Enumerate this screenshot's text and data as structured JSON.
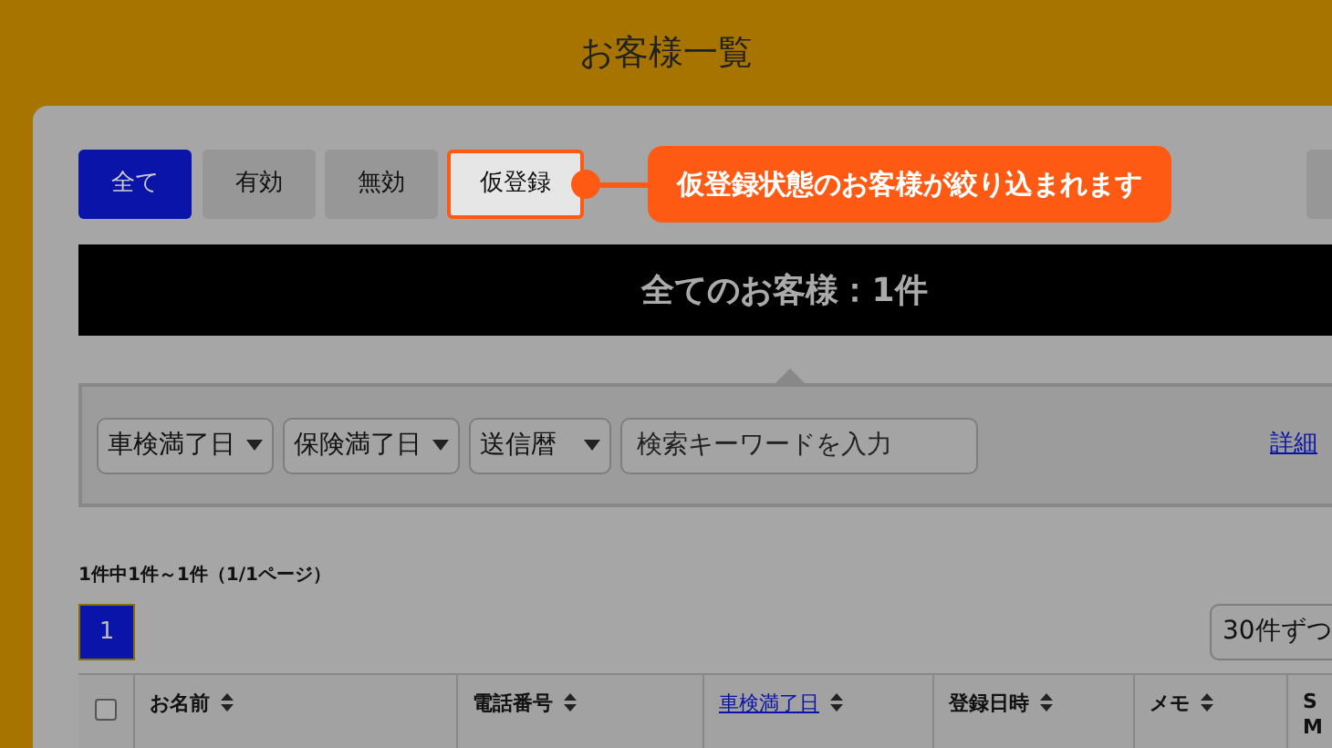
{
  "page_title": "お客様一覧",
  "filter_tabs": [
    {
      "label": "全て",
      "selected": true,
      "highlighted": false
    },
    {
      "label": "有効",
      "selected": false,
      "highlighted": false
    },
    {
      "label": "無効",
      "selected": false,
      "highlighted": false
    },
    {
      "label": "仮登録",
      "selected": false,
      "highlighted": true
    }
  ],
  "callout": {
    "text": "仮登録状態のお客様が絞り込まれます"
  },
  "summary": "全てのお客様：1件",
  "filters": {
    "dropdowns": [
      {
        "label": "車検満了日"
      },
      {
        "label": "保険満了日"
      },
      {
        "label": "送信暦"
      }
    ],
    "search": {
      "placeholder": "検索キーワードを入力"
    },
    "detail_link": "詳細"
  },
  "result_count": "1件中1件～1件（1/1ページ）",
  "pagination": [
    {
      "label": "1",
      "selected": true
    }
  ],
  "per_page": "30件ずつ",
  "table": {
    "select_all": {
      "checked": false
    },
    "columns": [
      {
        "label": "お名前",
        "kind": "plain",
        "sortable": true
      },
      {
        "label": "電話番号",
        "kind": "plain",
        "sortable": true
      },
      {
        "label": "車検満了日",
        "kind": "link",
        "sortable": true
      },
      {
        "label": "登録日時",
        "kind": "plain",
        "sortable": true
      },
      {
        "label": "メモ",
        "kind": "plain",
        "sortable": true
      },
      {
        "label": "SM",
        "kind": "plain",
        "sortable": false
      }
    ]
  }
}
